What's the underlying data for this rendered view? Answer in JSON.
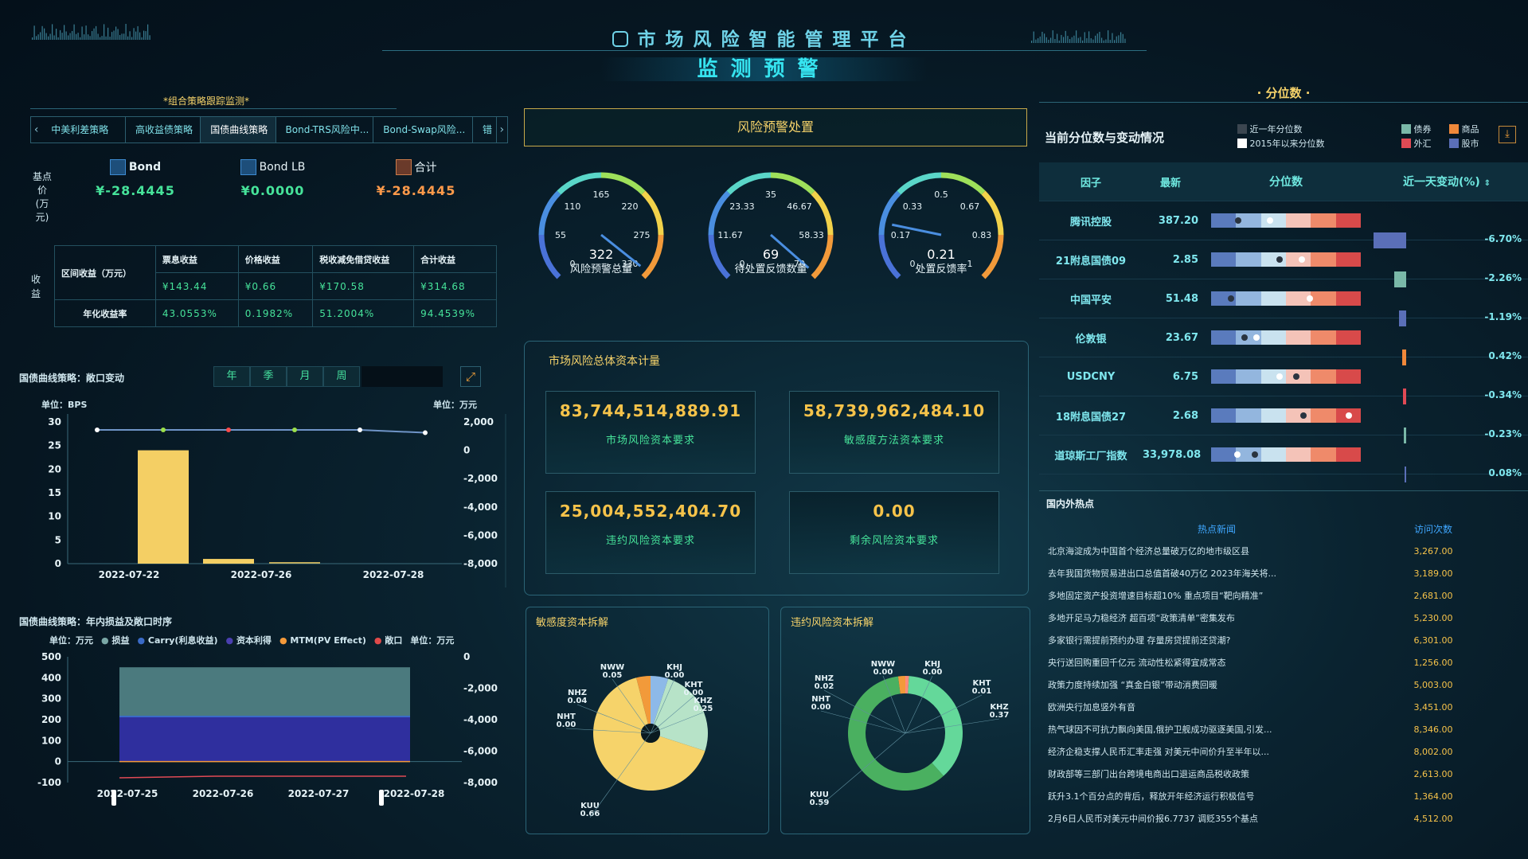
{
  "header": {
    "title": "市场风险智能管理平台",
    "subtitle": "监测预警"
  },
  "left": {
    "monitor_title": "*组合策略跟踪监测*",
    "tabs": [
      "中美利差策略",
      "高收益债策略",
      "国债曲线策略",
      "Bond-TRS风险中...",
      "Bond-Swap风险...",
      "错"
    ],
    "active_tab": 2,
    "basis_label": "基点价(万元)",
    "basis_items": [
      {
        "name": "Bond",
        "value": "¥-28.4445"
      },
      {
        "name": "Bond LB",
        "value": "¥0.0000"
      },
      {
        "name": "合计",
        "value": "¥-28.4445"
      }
    ],
    "income_label": "收益",
    "income_table": {
      "headers": [
        "区间收益（万元）",
        "票息收益",
        "价格收益",
        "税收减免借贷收益",
        "合计收益"
      ],
      "rows": [
        [
          "",
          "¥143.44",
          "¥0.66",
          "¥170.58",
          "¥314.68"
        ],
        [
          "年化收益率",
          "43.0553%",
          "0.1982%",
          "51.2004%",
          "94.4539%"
        ]
      ]
    },
    "chart1": {
      "title": "国债曲线策略：敞口变动",
      "periods": [
        "年",
        "季",
        "月",
        "周"
      ],
      "unit_left": "单位：BPS",
      "unit_right": "单位：万元"
    },
    "chart2": {
      "title": "国债曲线策略：年内损益及敞口时序",
      "unit_left": "单位：万元",
      "unit_right": "单位：万元",
      "legend": [
        "损益",
        "Carry(利息收益)",
        "资本利得",
        "MTM(PV Effect)",
        "敞口"
      ]
    }
  },
  "center": {
    "alert_title": "风险预警处置",
    "gauges": [
      {
        "label": "风险预警总量",
        "value": "322",
        "ticks": [
          "0",
          "55",
          "110",
          "165",
          "220",
          "275",
          "330"
        ],
        "fraction": 0.976
      },
      {
        "label": "待处置反馈数量",
        "value": "69",
        "ticks": [
          "0",
          "11.67",
          "23.33",
          "35",
          "46.67",
          "58.33",
          "70"
        ],
        "fraction": 0.986
      },
      {
        "label": "处置反馈率",
        "value": "0.21",
        "ticks": [
          "0",
          "0.17",
          "0.33",
          "0.5",
          "0.67",
          "0.83",
          "1"
        ],
        "fraction": 0.21
      }
    ],
    "capital_title": "市场风险总体资本计量",
    "capital_cards": [
      {
        "value": "83,744,514,889.91",
        "label": "市场风险资本要求"
      },
      {
        "value": "58,739,962,484.10",
        "label": "敏感度方法资本要求"
      },
      {
        "value": "25,004,552,404.70",
        "label": "违约风险资本要求"
      },
      {
        "value": "0.00",
        "label": "剩余风险资本要求"
      }
    ],
    "sens_title": "敏感度资本拆解",
    "default_title": "违约风险资本拆解"
  },
  "right": {
    "quantile_title": "· 分位数 ·",
    "table_title": "当前分位数与变动情况",
    "legend": [
      "近一年分位数",
      "2015年以来分位数",
      "债券",
      "商品",
      "外汇",
      "股市"
    ],
    "columns": [
      "因子",
      "最新",
      "分位数",
      "近一天变动(%)"
    ],
    "rows": [
      {
        "name": "腾讯控股",
        "latest": "387.20",
        "change": "-6.70%"
      },
      {
        "name": "21附息国债09",
        "latest": "2.85",
        "change": "-2.26%"
      },
      {
        "name": "中国平安",
        "latest": "51.48",
        "change": "-1.19%"
      },
      {
        "name": "伦敦银",
        "latest": "23.67",
        "change": "0.42%"
      },
      {
        "name": "USDCNY",
        "latest": "6.75",
        "change": "-0.34%"
      },
      {
        "name": "18附息国债27",
        "latest": "2.68",
        "change": "-0.23%"
      },
      {
        "name": "道琼斯工厂指数",
        "latest": "33,978.08",
        "change": "0.08%"
      }
    ],
    "news_title": "国内外热点",
    "news_headers": [
      "热点新闻",
      "访问次数"
    ],
    "news": [
      [
        "北京海淀成为中国首个经济总量破万亿的地市级区县",
        "3,267.00"
      ],
      [
        "去年我国货物贸易进出口总值首破40万亿 2023年海关将...",
        "3,189.00"
      ],
      [
        "多地固定资产投资增速目标超10% 重点项目“靶向精准”",
        "2,681.00"
      ],
      [
        "多地开足马力稳经济 超百项“政策清单”密集发布",
        "5,230.00"
      ],
      [
        "多家银行需提前预约办理 存量房贷提前还贷潮?",
        "6,301.00"
      ],
      [
        "央行送回购重回千亿元 流动性松紧得宜成常态",
        "1,256.00"
      ],
      [
        "政策力度持续加强 “真金白银”带动消费回暖",
        "5,003.00"
      ],
      [
        "欧洲央行加息竖外有音",
        "3,451.00"
      ],
      [
        "热气球因不可抗力飘向美国,俄护卫舰成功驱逐美国,引发...",
        "8,346.00"
      ],
      [
        "经济企稳支撑人民币汇率走强 对美元中间价升至半年以...",
        "8,002.00"
      ],
      [
        "财政部等三部门出台跨境电商出口退运商品税收政策",
        "2,613.00"
      ],
      [
        "跃升3.1个百分点的背后，释放开年经济运行积极信号",
        "1,364.00"
      ],
      [
        "2月6日人民币对美元中间价报6.7737 调贬355个基点",
        "4,512.00"
      ]
    ]
  },
  "chart_data": [
    {
      "type": "bar",
      "title": "国债曲线策略：敞口变动",
      "x": [
        "2022-07-22",
        "2022-07-26",
        "2022-07-28"
      ],
      "ylabel": "BPS",
      "ylim": [
        0,
        30
      ],
      "y2lim": [
        -8000,
        2000
      ],
      "bars": [
        24,
        1,
        0
      ],
      "line": [
        2000,
        2000,
        2000,
        2000,
        2000,
        1800
      ]
    },
    {
      "type": "area",
      "title": "国债曲线策略：年内损益及敞口时序",
      "x": [
        "2022-07-25",
        "2022-07-26",
        "2022-07-27",
        "2022-07-28"
      ],
      "ylim": [
        -100,
        500
      ],
      "y2lim": [
        -8000,
        0
      ],
      "series": [
        {
          "name": "损益",
          "values": [
            450,
            450,
            450,
            450
          ]
        },
        {
          "name": "Carry(利息收益)",
          "values": [
            215,
            215,
            215,
            215
          ]
        },
        {
          "name": "资本利得",
          "values": [
            210,
            210,
            210,
            210
          ]
        },
        {
          "name": "MTM(PV Effect)",
          "values": [
            0,
            0,
            0,
            0
          ]
        },
        {
          "name": "敞口",
          "values": [
            -8000,
            -7900,
            -7900,
            -7900
          ]
        }
      ]
    },
    {
      "type": "pie",
      "title": "敏感度资本拆解",
      "labels": [
        "NWW",
        "KHJ",
        "KHT",
        "KHZ",
        "KUU",
        "NHT",
        "NHZ"
      ],
      "values": [
        0.05,
        0.0,
        0.0,
        0.25,
        0.66,
        0.0,
        0.04
      ]
    },
    {
      "type": "pie",
      "title": "违约风险资本拆解",
      "labels": [
        "NWW",
        "KHJ",
        "KHT",
        "KHZ",
        "KUU",
        "NHT",
        "NHZ"
      ],
      "values": [
        0.0,
        0.0,
        0.01,
        0.37,
        0.59,
        0.0,
        0.02
      ]
    }
  ]
}
